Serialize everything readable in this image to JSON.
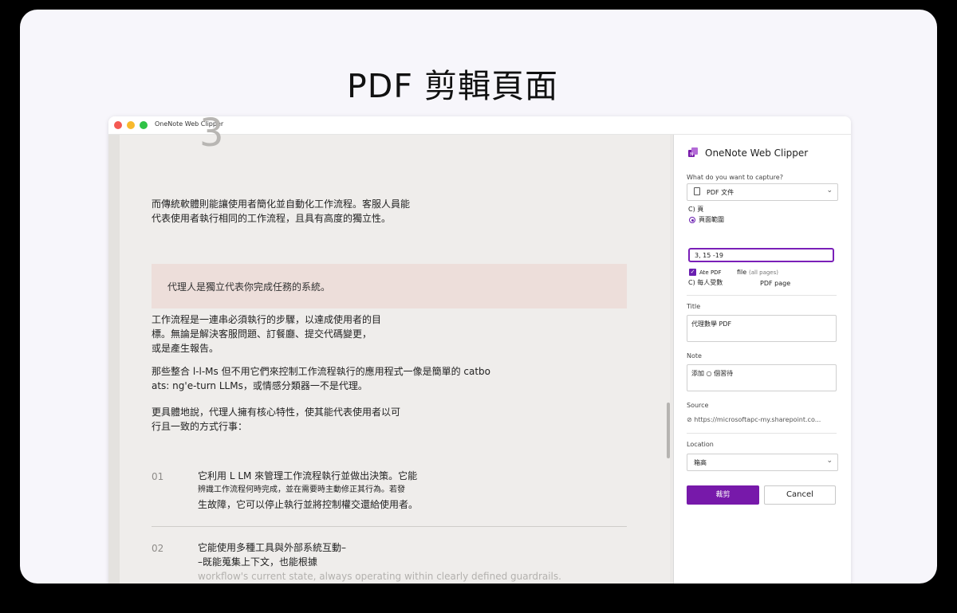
{
  "heading": "PDF 剪輯頁面",
  "window": {
    "title": "OneNote Web Clipper"
  },
  "document": {
    "big_numeral": "3",
    "para1": [
      "而傳統軟體則能讓使用者簡化並自動化工作流程。客服人員能",
      "代表使用者執行相同的工作流程，且具有高度的獨立性。"
    ],
    "callout": "代理人是獨立代表你完成任務的系統。",
    "para2": [
      "工作流程是一連串必須執行的步驟，以達成使用者的目",
      "標。無論是解決客服問題、訂餐廳、提交代碼變更，",
      "或是產生報告。"
    ],
    "para3": [
      "那些整合 l-l-Ms 但不用它們來控制工作流程執行的應用程式一像是簡單的 catbo",
      "ats: ng'e-turn LLMs，或情感分類器一不是代理。"
    ],
    "para4": [
      "更具體地說，代理人擁有核心特性，使其能代表使用者以可",
      "行且一致的方式行事："
    ],
    "items": [
      {
        "num": "01",
        "lines": [
          "它利用 L LM 來管理工作流程執行並做出決策。它能",
          "辨識工作流程何時完成，並在需要時主動修正其行為。若發",
          "生故障，它可以停止執行並將控制權交還給使用者。"
        ]
      },
      {
        "num": "02",
        "lines": [
          "它能使用多種工具與外部系統互動–",
          "–既能蒐集上下文，也能根據",
          "workflow's current state, always operating within clearly defined guardrails."
        ]
      }
    ]
  },
  "panel": {
    "app_name": "OneNote Web Clipper",
    "capture_label": "What do you want to capture?",
    "capture_value": "PDF 文件",
    "option_page": "C) 頁",
    "option_range": "頁面範圍",
    "range_value": "3, 15 -19",
    "attach_label": "Ate PDF",
    "attach_file": "file",
    "attach_hint": "(all pages)",
    "each_page_label": "C) 每人受數",
    "pdf_page": "PDF page",
    "title_label": "Title",
    "title_value": "代理數學 PDF",
    "note_label": "Note",
    "note_value": "添加 ○ 個習待",
    "source_label": "Source",
    "source_value": "https://microsoftapc-my.sharepoint.co...",
    "location_label": "Location",
    "location_value": "箱高",
    "clip_button": "裁剪",
    "cancel_button": "Cancel"
  },
  "colors": {
    "accent": "#7719aa",
    "close": "#f45952",
    "minimize": "#f8b92c",
    "maximize": "#2fc246"
  }
}
